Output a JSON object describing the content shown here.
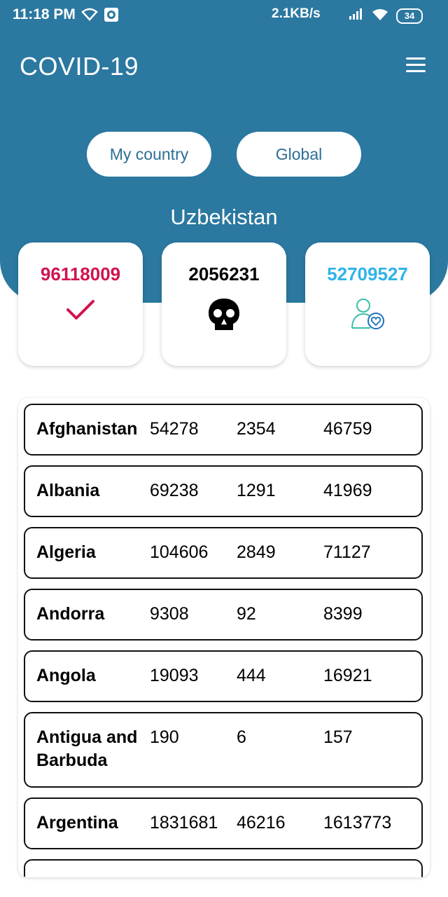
{
  "status_bar": {
    "time": "11:18 PM",
    "speed": "2.1KB/s",
    "network": "4G",
    "battery": "34"
  },
  "header": {
    "title": "COVID-19",
    "tabs": [
      "My country",
      "Global"
    ],
    "country": "Uzbekistan"
  },
  "stats": {
    "confirmed": "96118009",
    "deaths": "2056231",
    "recovered": "52709527",
    "colors": {
      "confirmed": "#d0144e",
      "deaths": "#000000",
      "recovered": "#2fb3e8"
    }
  },
  "countries": [
    {
      "name": "Afghanistan",
      "confirmed": "54278",
      "deaths": "2354",
      "recovered": "46759"
    },
    {
      "name": "Albania",
      "confirmed": "69238",
      "deaths": "1291",
      "recovered": "41969"
    },
    {
      "name": "Algeria",
      "confirmed": "104606",
      "deaths": "2849",
      "recovered": "71127"
    },
    {
      "name": "Andorra",
      "confirmed": "9308",
      "deaths": "92",
      "recovered": "8399"
    },
    {
      "name": "Angola",
      "confirmed": "19093",
      "deaths": "444",
      "recovered": "16921"
    },
    {
      "name": "Antigua and Barbuda",
      "confirmed": "190",
      "deaths": "6",
      "recovered": "157"
    },
    {
      "name": "Argentina",
      "confirmed": "1831681",
      "deaths": "46216",
      "recovered": "1613773"
    }
  ]
}
